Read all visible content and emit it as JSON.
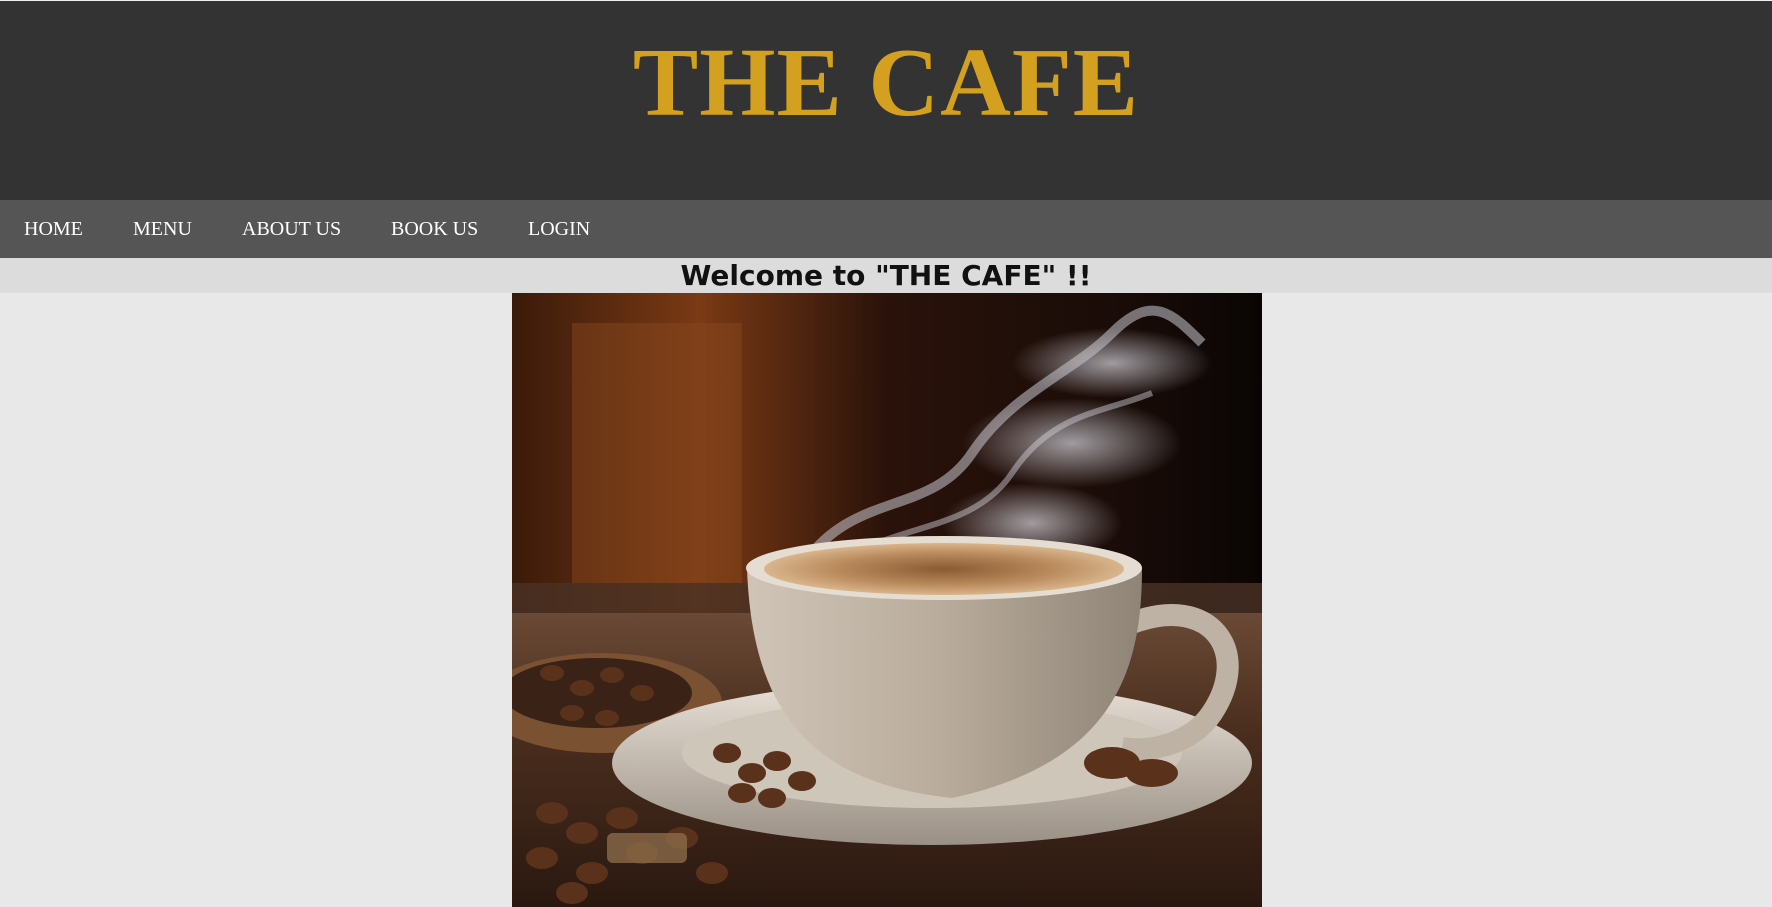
{
  "header": {
    "site_title": "THE CAFE",
    "title_color": "#d4a020",
    "background": "#333333"
  },
  "nav": {
    "items": [
      {
        "id": "home",
        "label": "HOME"
      },
      {
        "id": "menu",
        "label": "MENU"
      },
      {
        "id": "about",
        "label": "ABOUT US"
      },
      {
        "id": "book",
        "label": "BOOK US"
      },
      {
        "id": "login",
        "label": "LOGIN"
      }
    ],
    "background": "#555555"
  },
  "main": {
    "welcome": "Welcome to \"THE CAFE\" !!",
    "hero_image": "coffee-cup-with-steam-and-beans"
  }
}
